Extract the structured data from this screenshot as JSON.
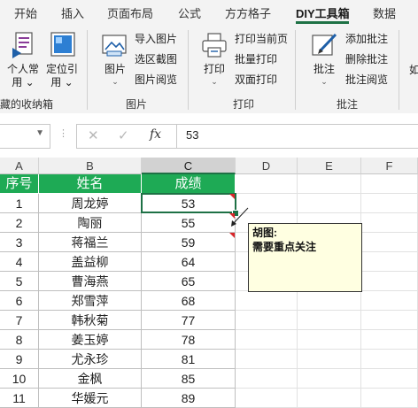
{
  "tabs": [
    "开始",
    "插入",
    "页面布局",
    "公式",
    "方方格子",
    "DIY工具箱",
    "数据"
  ],
  "active_tab": "DIY工具箱",
  "ribbon": {
    "group0": {
      "btn1_line1": "个人常",
      "btn1_line2": "用",
      "btn2_line1": "定位引",
      "btn2_line2": "用",
      "label": "藏的收纳箱"
    },
    "group_image": {
      "big": "图片",
      "items": [
        "导入图片",
        "选区截图",
        "图片阅览"
      ],
      "label": "图片"
    },
    "group_print": {
      "big": "打印",
      "items": [
        "打印当前页",
        "批量打印",
        "双面打印"
      ],
      "label": "打印"
    },
    "group_comment": {
      "big": "批注",
      "items": [
        "添加批注",
        "删除批注",
        "批注阅览"
      ],
      "label": "批注"
    },
    "cut_label": "如"
  },
  "formula_bar": {
    "value": "53",
    "fx": "fx"
  },
  "columns": [
    "A",
    "B",
    "C",
    "D",
    "E",
    "F"
  ],
  "header_row": [
    "序号",
    "姓名",
    "成绩"
  ],
  "rows": [
    [
      "1",
      "周龙婷",
      "53"
    ],
    [
      "2",
      "陶丽",
      "55"
    ],
    [
      "3",
      "蒋福兰",
      "59"
    ],
    [
      "4",
      "盖益柳",
      "64"
    ],
    [
      "5",
      "曹海燕",
      "65"
    ],
    [
      "6",
      "郑雪萍",
      "68"
    ],
    [
      "7",
      "韩秋菊",
      "77"
    ],
    [
      "8",
      "姜玉婷",
      "78"
    ],
    [
      "9",
      "尤永珍",
      "81"
    ],
    [
      "10",
      "金枫",
      "85"
    ],
    [
      "11",
      "华媛元",
      "89"
    ]
  ],
  "comment": {
    "author": "胡图:",
    "text": "需要重点关注"
  },
  "colors": {
    "accent": "#1e7145",
    "header_fill": "#1eaa55",
    "comment_fill": "#ffffe1",
    "comment_marker": "#d9262a"
  }
}
